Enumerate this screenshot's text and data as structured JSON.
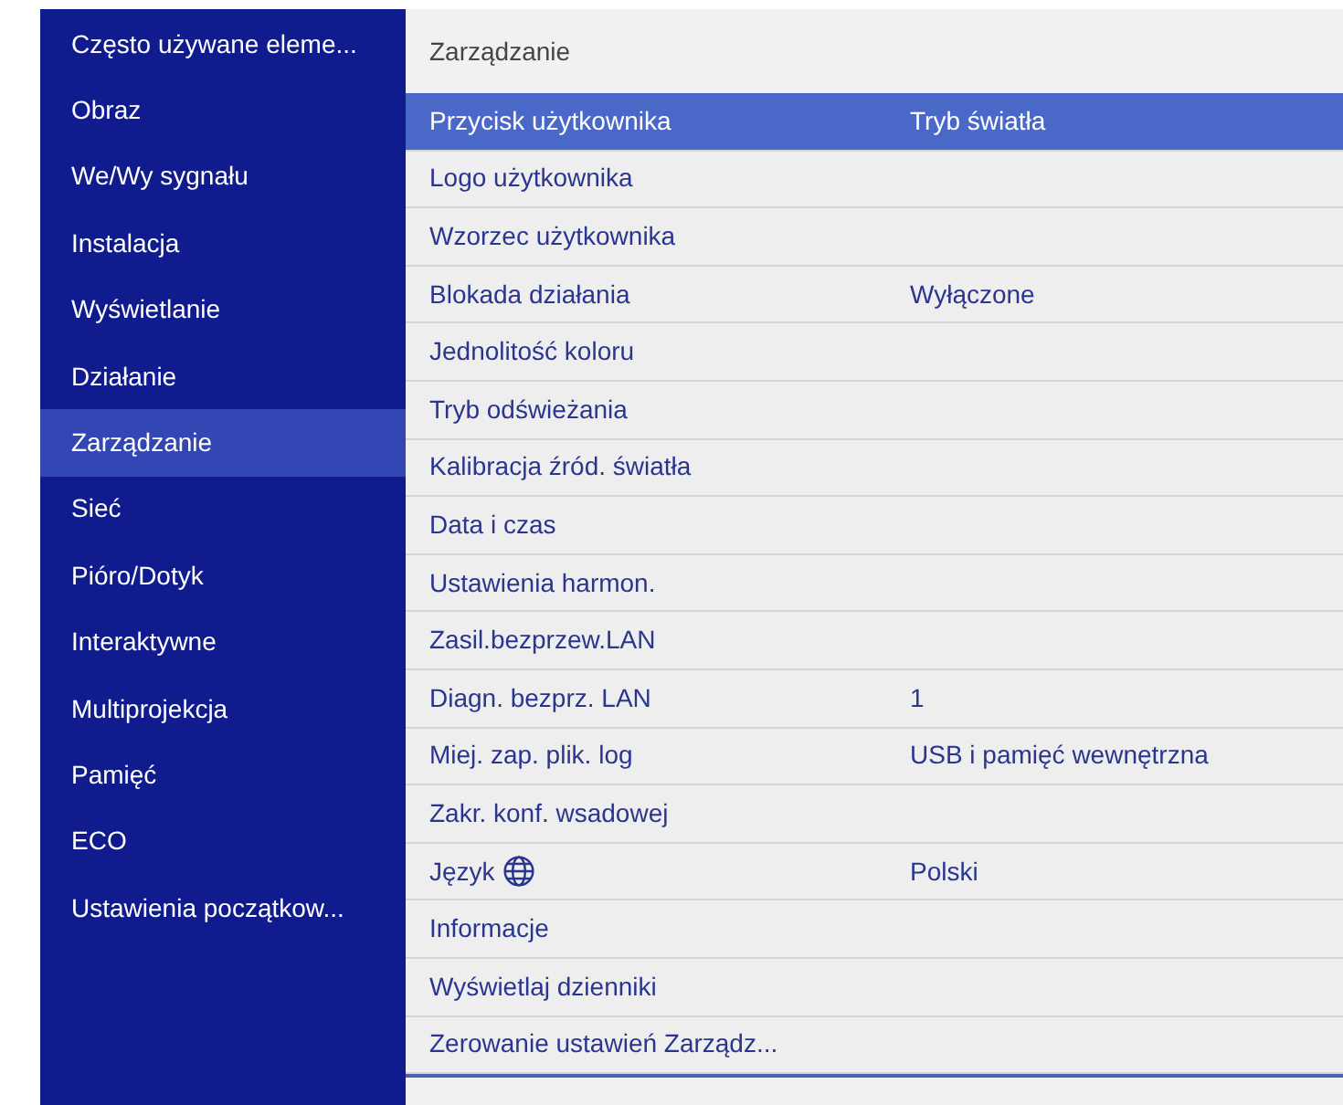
{
  "sidebar": {
    "items": [
      {
        "label": "Często używane eleme...",
        "selected": false
      },
      {
        "label": "Obraz",
        "selected": false
      },
      {
        "label": "We/Wy sygnału",
        "selected": false
      },
      {
        "label": "Instalacja",
        "selected": false
      },
      {
        "label": "Wyświetlanie",
        "selected": false
      },
      {
        "label": "Działanie",
        "selected": false
      },
      {
        "label": "Zarządzanie",
        "selected": true
      },
      {
        "label": "Sieć",
        "selected": false
      },
      {
        "label": "Pióro/Dotyk",
        "selected": false
      },
      {
        "label": "Interaktywne",
        "selected": false
      },
      {
        "label": "Multiprojekcja",
        "selected": false
      },
      {
        "label": "Pamięć",
        "selected": false
      },
      {
        "label": "ECO",
        "selected": false
      },
      {
        "label": "Ustawienia początkow...",
        "selected": false
      }
    ]
  },
  "panel": {
    "title": "Zarządzanie",
    "rows": [
      {
        "kind": "setting",
        "label": "Przycisk użytkownika",
        "value": "Tryb światła",
        "selected": true
      },
      {
        "kind": "setting",
        "label": "Logo użytkownika",
        "selected": false
      },
      {
        "kind": "setting",
        "label": "Wzorzec użytkownika",
        "selected": false
      },
      {
        "kind": "setting",
        "label": "Blokada działania",
        "value": "Wyłączone",
        "selected": false
      },
      {
        "kind": "setting",
        "label": "Jednolitość koloru",
        "selected": false
      },
      {
        "kind": "setting",
        "label": "Tryb odświeżania",
        "selected": false
      },
      {
        "kind": "setting",
        "label": "Kalibracja źród. światła",
        "selected": false
      },
      {
        "kind": "setting",
        "label": "Data i czas",
        "selected": false
      },
      {
        "kind": "setting",
        "label": "Ustawienia harmon.",
        "selected": false
      },
      {
        "kind": "setting",
        "label": "Zasil.bezprzew.LAN",
        "selected": false
      },
      {
        "kind": "setting",
        "label": "Diagn. bezprz. LAN",
        "value": "1",
        "selected": false
      },
      {
        "kind": "setting",
        "label": "Miej. zap. plik. log",
        "value": "USB i pamięć wewnętrzna",
        "selected": false
      },
      {
        "kind": "setting",
        "label": "Zakr. konf. wsadowej",
        "selected": false
      },
      {
        "kind": "language",
        "label": "Język",
        "value": "Polski",
        "selected": false
      },
      {
        "kind": "setting",
        "label": "Informacje",
        "selected": false
      },
      {
        "kind": "setting",
        "label": "Wyświetlaj dzienniki",
        "selected": false
      },
      {
        "kind": "setting",
        "label": "Zerowanie ustawień Zarządz...",
        "selected": false
      }
    ]
  }
}
